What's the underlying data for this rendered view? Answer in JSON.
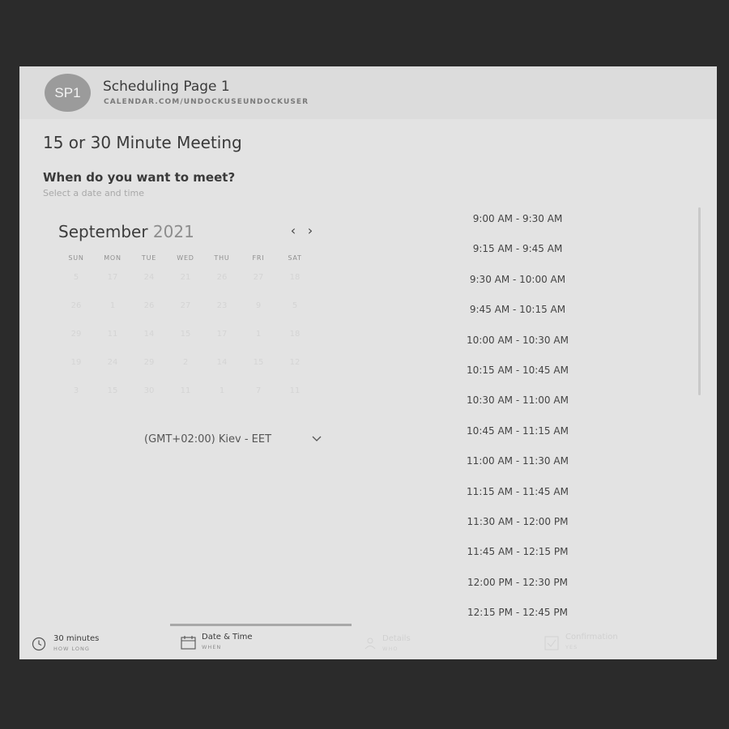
{
  "header": {
    "avatar_initials": "SP1",
    "page_name": "Scheduling Page 1",
    "page_url": "CALENDAR.COM/UNDOCKUSEUNDOCKUSER"
  },
  "meeting": {
    "title": "15 or 30 Minute Meeting",
    "question": "When do you want to meet?",
    "hint": "Select a date and time"
  },
  "calendar": {
    "month": "September",
    "year": "2021",
    "weekdays": [
      "SUN",
      "MON",
      "TUE",
      "WED",
      "THU",
      "FRI",
      "SAT"
    ],
    "weeks": [
      [
        "5",
        "17",
        "24",
        "21",
        "26",
        "27",
        "18"
      ],
      [
        "26",
        "1",
        "26",
        "27",
        "23",
        "9",
        "5"
      ],
      [
        "29",
        "11",
        "14",
        "15",
        "17",
        "1",
        "18"
      ],
      [
        "19",
        "24",
        "29",
        "2",
        "14",
        "15",
        "12"
      ],
      [
        "3",
        "15",
        "30",
        "11",
        "1",
        "7",
        "11"
      ]
    ]
  },
  "timezone": {
    "value": "(GMT+02:00) Kiev - EET"
  },
  "time_slots": [
    "9:00 AM - 9:30 AM",
    "9:15 AM - 9:45 AM",
    "9:30 AM - 10:00 AM",
    "9:45 AM - 10:15 AM",
    "10:00 AM - 10:30 AM",
    "10:15 AM - 10:45 AM",
    "10:30 AM - 11:00 AM",
    "10:45 AM - 11:15 AM",
    "11:00 AM - 11:30 AM",
    "11:15 AM - 11:45 AM",
    "11:30 AM - 12:00 PM",
    "11:45 AM - 12:15 PM",
    "12:00 PM - 12:30 PM",
    "12:15 PM - 12:45 PM"
  ],
  "steps": [
    {
      "label": "30 minutes",
      "sub": "HOW LONG",
      "icon": "clock-icon"
    },
    {
      "label": "Date & Time",
      "sub": "WHEN",
      "icon": "calendar-icon"
    },
    {
      "label": "Details",
      "sub": "WHO",
      "icon": "person-icon"
    },
    {
      "label": "Confirmation",
      "sub": "YES",
      "icon": "check-icon"
    }
  ],
  "colors": {
    "background": "#2b2b2b",
    "card": "#e3e3e3",
    "avatar": "#9b9b9b"
  }
}
